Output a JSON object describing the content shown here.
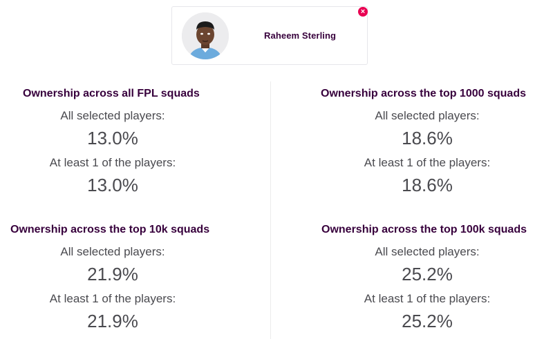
{
  "player": {
    "name": "Raheem Sterling",
    "avatar_icon": "player-photo",
    "remove_icon": "close-icon",
    "remove_color": "#e90052"
  },
  "sections": [
    {
      "title": "Ownership across all FPL squads",
      "all_label": "All selected players:",
      "all_value": "13.0%",
      "atleast_label": "At least 1 of the players:",
      "atleast_value": "13.0%"
    },
    {
      "title": "Ownership across the top 1000 squads",
      "all_label": "All selected players:",
      "all_value": "18.6%",
      "atleast_label": "At least 1 of the players:",
      "atleast_value": "18.6%"
    },
    {
      "title": "Ownership across the top 10k squads",
      "all_label": "All selected players:",
      "all_value": "21.9%",
      "atleast_label": "At least 1 of the players:",
      "atleast_value": "21.9%"
    },
    {
      "title": "Ownership across the top 100k squads",
      "all_label": "All selected players:",
      "all_value": "25.2%",
      "atleast_label": "At least 1 of the players:",
      "atleast_value": "25.2%"
    }
  ],
  "colors": {
    "heading": "#37003c",
    "text": "#4a4a4f"
  }
}
